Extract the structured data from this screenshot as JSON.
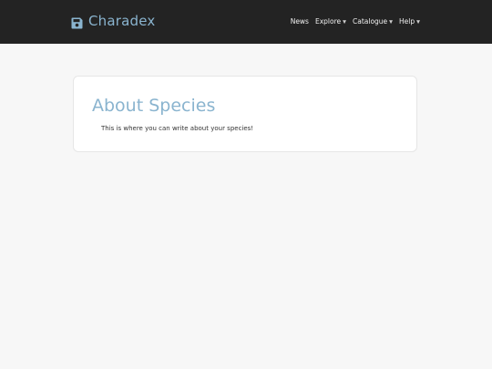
{
  "header": {
    "brand_name": "Charadex",
    "brand_icon": "floppy-disk-icon",
    "colors": {
      "background": "#232323",
      "brand": "#8ab4cf",
      "nav_text": "#f0f0f0"
    },
    "nav": [
      {
        "label": "News",
        "has_dropdown": false
      },
      {
        "label": "Explore",
        "has_dropdown": true
      },
      {
        "label": "Catalogue",
        "has_dropdown": true
      },
      {
        "label": "Help",
        "has_dropdown": true
      }
    ]
  },
  "main": {
    "title": "About Species",
    "body": "This is where you can write about your species!",
    "colors": {
      "page_background": "#f7f7f7",
      "card_background": "#ffffff",
      "title": "#8ab4cf"
    }
  }
}
